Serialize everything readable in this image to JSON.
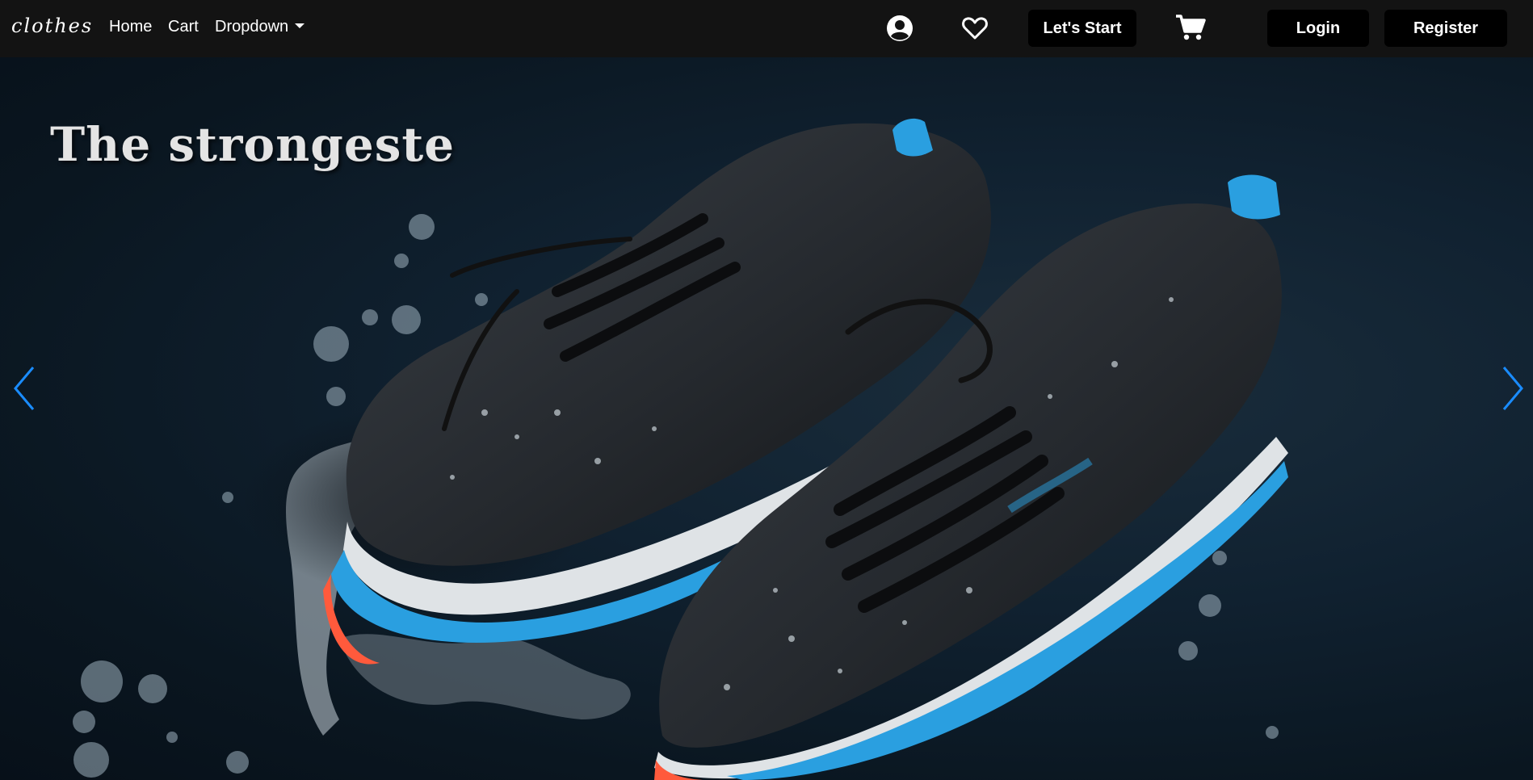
{
  "navbar": {
    "brand": "clothes",
    "links": {
      "home": "Home",
      "cart": "Cart",
      "dropdown": "Dropdown"
    },
    "icons": {
      "account": "user-circle-icon",
      "wishlist": "heart-icon",
      "cart": "shopping-cart-icon"
    },
    "lets_start_label": "Let's Start",
    "login_label": "Login",
    "register_label": "Register"
  },
  "hero": {
    "title": "The strongeste",
    "image": "wet-black-running-shoes",
    "prev_icon": "chevron-left-icon",
    "next_icon": "chevron-right-icon"
  },
  "colors": {
    "navbar_bg": "#131313",
    "button_bg": "#000000",
    "carousel_arrow": "#1a8cff",
    "accent_blue": "#2a9fe0",
    "sole_orange": "#ff5a3c"
  }
}
